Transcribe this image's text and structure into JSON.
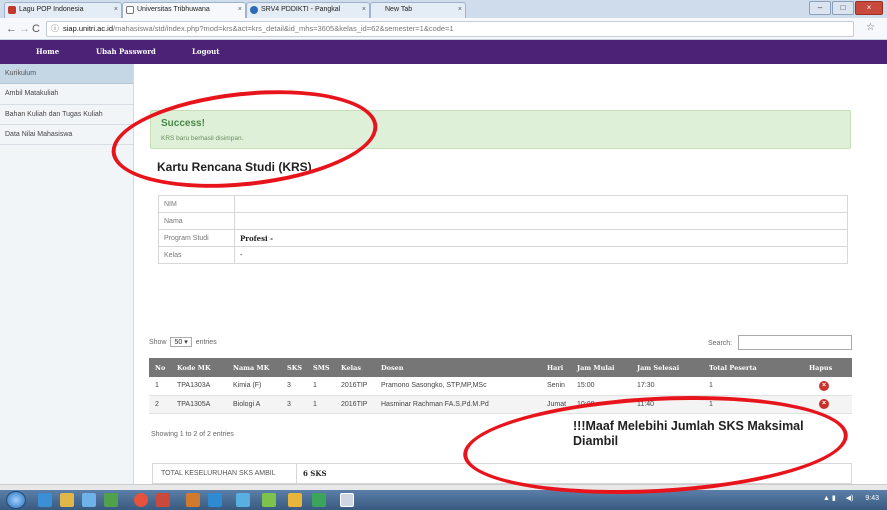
{
  "browser": {
    "tabs": [
      {
        "label": "Lagu POP Indonesia"
      },
      {
        "label": "Universitas Tribhuwana"
      },
      {
        "label": "SRV4 PDDIKTI - Pangkal"
      },
      {
        "label": "New Tab"
      }
    ],
    "url_host": "siap.unitri.ac.id",
    "url_path": "/mahasiswa/std/index.php?mod=krs&act=krs_detail&id_mhs=3605&kelas_id=62&semester=1&code=1",
    "window_buttons": [
      "minimize-icon",
      "maximize-icon",
      "close-icon"
    ]
  },
  "nav": {
    "home": "Home",
    "change_password": "Ubah Password",
    "logout": "Logout"
  },
  "sidebar": {
    "header": "Kurikulum",
    "items": [
      {
        "label": "Ambil Matakuliah"
      },
      {
        "label": "Bahan Kuliah dan Tugas Kuliah"
      },
      {
        "label": "Data Nilai Mahasiswa"
      }
    ]
  },
  "alert": {
    "title": "Success!",
    "message": "KRS baru berhasil disimpan."
  },
  "page_title": "Kartu Rencana Studi (KRS)",
  "student_info": [
    {
      "label": "NIM",
      "value": ""
    },
    {
      "label": "Nama",
      "value": ""
    },
    {
      "label": "Program Studi",
      "value": "Profesi -"
    },
    {
      "label": "Kelas",
      "value": "-"
    }
  ],
  "table_controls": {
    "show_prefix": "Show",
    "show_value": "50",
    "show_suffix": "entries",
    "search_label": "Search:",
    "search_value": ""
  },
  "krs_table": {
    "columns": [
      "No",
      "Kode MK",
      "Nama MK",
      "SKS",
      "SMS",
      "Kelas",
      "Dosen",
      "Hari",
      "Jam Mulai",
      "Jam Selesai",
      "Total Peserta",
      "Hapus"
    ],
    "rows": [
      {
        "no": "1",
        "kode": "TPA1303A",
        "nama": "Kimia (F)",
        "sks": "3",
        "sms": "1",
        "kelas": "2016TIP",
        "dosen": "Pramono Sasongko, STP,MP,MSc",
        "hari": "Senin",
        "mulai": "15:00",
        "selesai": "17:30",
        "peserta": "1"
      },
      {
        "no": "2",
        "kode": "TPA1305A",
        "nama": "Biologi A",
        "sks": "3",
        "sms": "1",
        "kelas": "2016TIP",
        "dosen": "Hasminar Rachman FA.S.Pd.M.Pd",
        "hari": "Jumat",
        "mulai": "10:00",
        "selesai": "11:40",
        "peserta": "1"
      }
    ]
  },
  "showing_text": "Showing 1 to 2 of 2 entries",
  "warning": "!!!Maaf Melebihi Jumlah SKS Maksimal Diambil",
  "total": {
    "label": "TOTAL KESELURUHAN SKS AMBIL",
    "value": "6 SKS"
  },
  "taskbar": {
    "clock": "9:43"
  },
  "colors": {
    "nav_bg": "#4b2276",
    "alert_bg": "#dff0d8",
    "annotation": "#e8141b",
    "table_header": "#767676"
  }
}
